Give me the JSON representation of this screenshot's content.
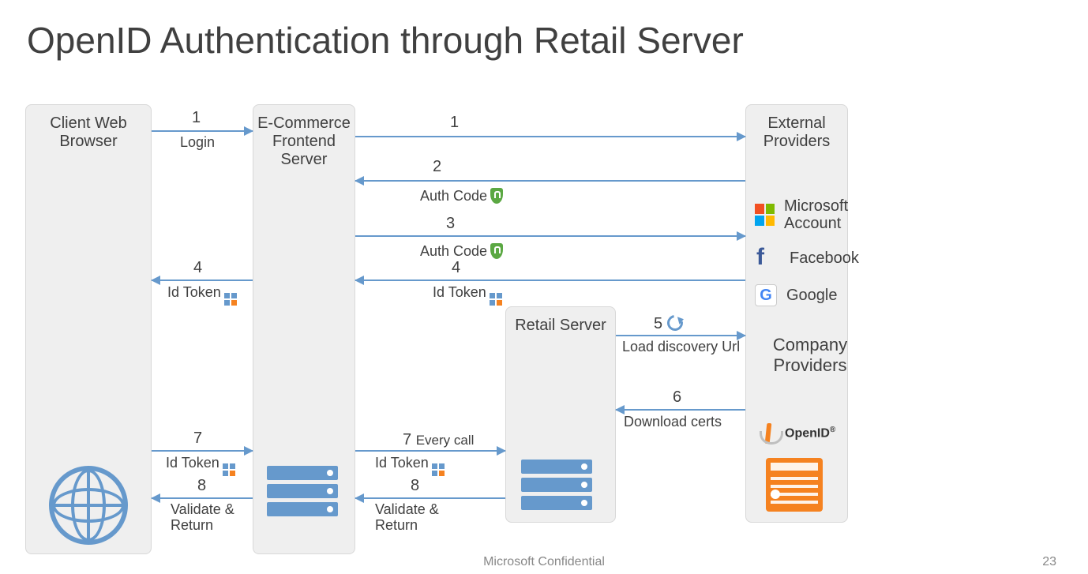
{
  "title": "OpenID Authentication through Retail Server",
  "footer": "Microsoft Confidential",
  "page_number": "23",
  "nodes": {
    "client": "Client Web Browser",
    "ecom": "E-Commerce Frontend Server",
    "retail": "Retail Server",
    "ext": "External Providers"
  },
  "providers": {
    "heading": "External Providers",
    "microsoft": "Microsoft Account",
    "facebook": "Facebook",
    "google": "Google",
    "company": "Company Providers",
    "openid": "OpenID"
  },
  "arrows": {
    "a1a": {
      "num": "1",
      "label": "Login"
    },
    "a1b": {
      "num": "1",
      "label": ""
    },
    "a2": {
      "num": "2",
      "label": "Auth Code"
    },
    "a3": {
      "num": "3",
      "label": "Auth Code"
    },
    "a4a": {
      "num": "4",
      "label": "Id Token"
    },
    "a4b": {
      "num": "4",
      "label": "Id Token"
    },
    "a5": {
      "num": "5",
      "label": "Load discovery Url"
    },
    "a6": {
      "num": "6",
      "label": "Download certs"
    },
    "a7a": {
      "num": "7",
      "label": "Id Token"
    },
    "a7b": {
      "num": "7",
      "sub": "Every call",
      "label": "Id Token"
    },
    "a8a": {
      "num": "8",
      "label": "Validate & Return"
    },
    "a8b": {
      "num": "8",
      "label": "Validate & Return"
    }
  }
}
